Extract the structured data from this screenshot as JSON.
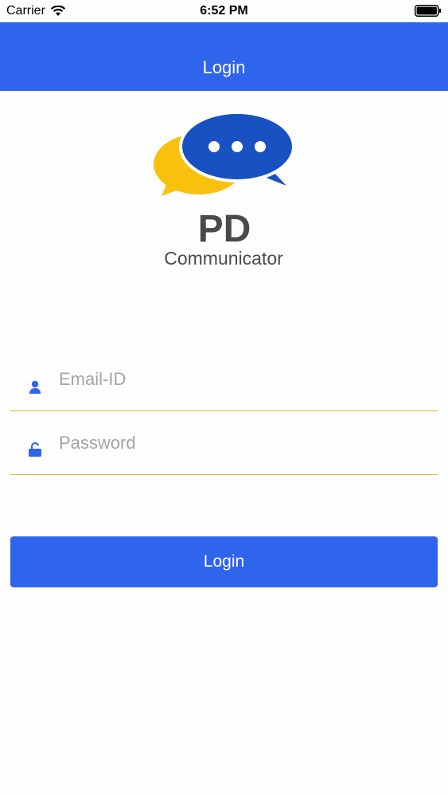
{
  "status_bar": {
    "carrier": "Carrier",
    "time": "6:52 PM",
    "wifi_icon": "wifi-icon",
    "battery_icon": "battery-icon"
  },
  "nav": {
    "title": "Login"
  },
  "logo": {
    "primary": "PD",
    "secondary": "Communicator",
    "icon": "chat-bubbles-logo"
  },
  "form": {
    "email": {
      "placeholder": "Email-ID",
      "value": "",
      "icon": "user-icon"
    },
    "password": {
      "placeholder": "Password",
      "value": "",
      "icon": "unlock-icon"
    },
    "submit_label": "Login"
  },
  "colors": {
    "accent": "#2f64ec",
    "underline": "#e6b24a",
    "logo_yellow": "#f8c10c",
    "logo_blue": "#1751c2",
    "logo_text": "#4a4a4a"
  }
}
